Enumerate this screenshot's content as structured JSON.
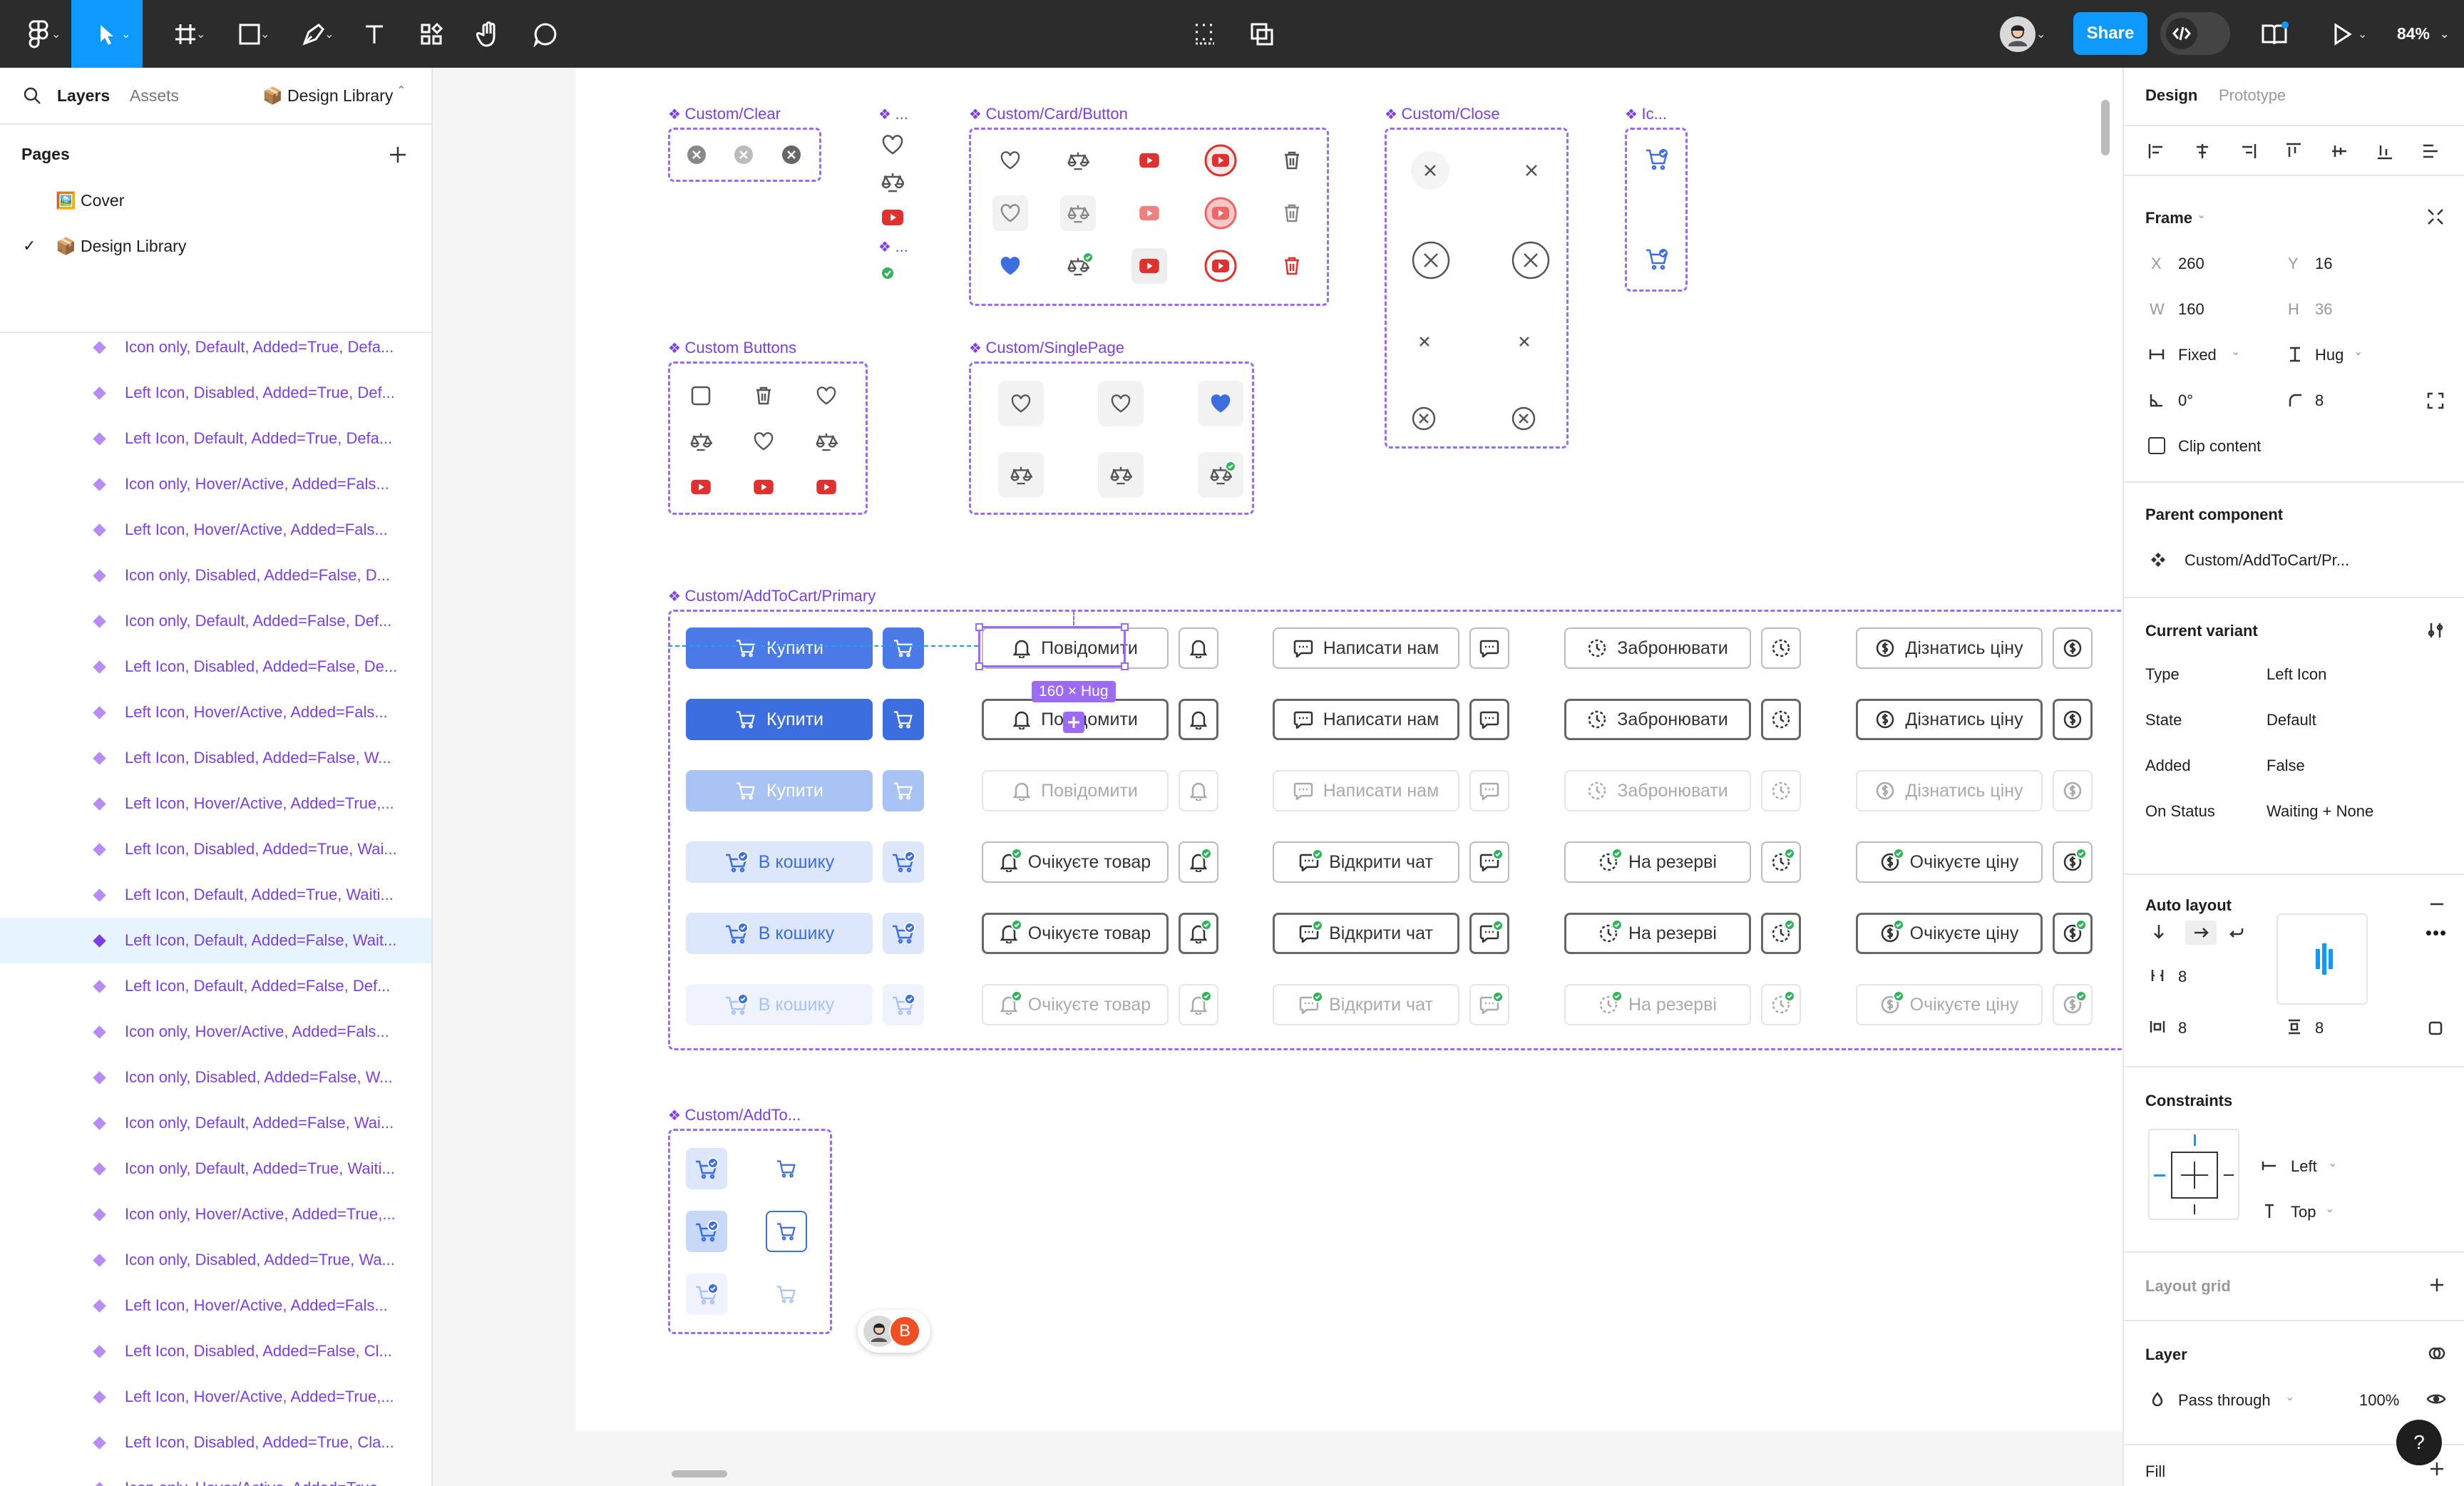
{
  "toolbar": {
    "share_label": "Share",
    "zoom": "84%",
    "tools": [
      "figma-menu",
      "move-tool",
      "frame-tool",
      "shape-tool",
      "pen-tool",
      "text-tool",
      "resources-tool",
      "hand-tool",
      "comment-tool"
    ],
    "accent": "#0d99ff",
    "bg": "#2c2c2c"
  },
  "left_panel": {
    "tabs": {
      "layers": "Layers",
      "assets": "Assets",
      "library": "📦 Design Library"
    },
    "pages_title": "Pages",
    "pages": [
      {
        "label": "🖼️ Cover",
        "checked": false
      },
      {
        "label": "📦 Design Library",
        "checked": true
      }
    ],
    "layers": [
      "Icon only, Default, Added=True, Defa...",
      "Left Icon, Disabled, Added=True, Def...",
      "Left Icon, Default, Added=True, Defa...",
      "Icon only, Hover/Active, Added=Fals...",
      "Left Icon, Hover/Active, Added=Fals...",
      "Icon only, Disabled, Added=False, D...",
      "Icon only, Default, Added=False, Def...",
      "Left Icon, Disabled, Added=False, De...",
      "Left Icon, Hover/Active, Added=Fals...",
      "Left Icon, Disabled, Added=False, W...",
      "Left Icon, Hover/Active, Added=True,...",
      "Left Icon, Disabled, Added=True, Wai...",
      "Left Icon, Default, Added=True, Waiti...",
      "Left Icon, Default, Added=False, Wait...",
      "Left Icon, Default, Added=False, Def...",
      "Icon only, Hover/Active, Added=Fals...",
      "Icon only, Disabled, Added=False, W...",
      "Icon only, Default, Added=False, Wai...",
      "Icon only, Default, Added=True, Waiti...",
      "Icon only, Hover/Active, Added=True,...",
      "Icon only, Disabled, Added=True, Wa...",
      "Left Icon, Hover/Active, Added=Fals...",
      "Left Icon, Disabled, Added=False, Cl...",
      "Left Icon, Hover/Active, Added=True,...",
      "Left Icon, Disabled, Added=True, Cla...",
      "Icon only, Hover/Active, Added=True,..."
    ],
    "selected_layer_index": 13
  },
  "canvas": {
    "frames": {
      "clear": "Custom/Clear",
      "dots": "...",
      "dots2": "...",
      "card_button": "Custom/Card/Button",
      "close": "Custom/Close",
      "ic": "Ic...",
      "custom_buttons": "Custom Buttons",
      "single_page": "Custom/SinglePage",
      "add_to_cart": "Custom/AddToCart/Primary",
      "add_to_small": "Custom/AddTo..."
    },
    "size_badge": "160 × Hug",
    "avatar_letter": "В",
    "buttons": {
      "buy": "Купити",
      "notify": "Повідомити",
      "write": "Написати нам",
      "reserve": "Забронювати",
      "price": "Дізнатись ціну",
      "in_cart": "В кошику",
      "awaiting": "Очікуєте товар",
      "open_chat": "Відкрити чат",
      "reserved": "На резерві",
      "awaiting_price": "Очікуєте ціну"
    },
    "colors": {
      "component": "#9b6bf2",
      "primary": "#3d6ee0",
      "youtube": "#e03131",
      "heart": "#3d6ee0",
      "success": "#2eb35b"
    }
  },
  "right_panel": {
    "tabs": {
      "design": "Design",
      "prototype": "Prototype"
    },
    "frame": {
      "title": "Frame",
      "x_label": "X",
      "x": "260",
      "y_label": "Y",
      "y": "16",
      "w_label": "W",
      "w": "160",
      "h_label": "H",
      "h": "36",
      "width_mode": "Fixed",
      "height_mode": "Hug",
      "rotation": "0°",
      "radius": "8",
      "clip_content": "Clip content"
    },
    "parent": {
      "title": "Parent component",
      "value": "Custom/AddToCart/Pr..."
    },
    "variant": {
      "title": "Current variant",
      "props": [
        {
          "k": "Type",
          "v": "Left Icon"
        },
        {
          "k": "State",
          "v": "Default"
        },
        {
          "k": "Added",
          "v": "False"
        },
        {
          "k": "On Status",
          "v": "Waiting + None"
        }
      ]
    },
    "auto_layout": {
      "title": "Auto layout",
      "gap": "8",
      "pad_h": "8",
      "pad_v": "8"
    },
    "constraints": {
      "title": "Constraints",
      "horizontal": "Left",
      "vertical": "Top"
    },
    "layout_grid": "Layout grid",
    "layer": {
      "title": "Layer",
      "blend": "Pass through",
      "opacity": "100%"
    },
    "fill": "Fill"
  },
  "help": "?"
}
